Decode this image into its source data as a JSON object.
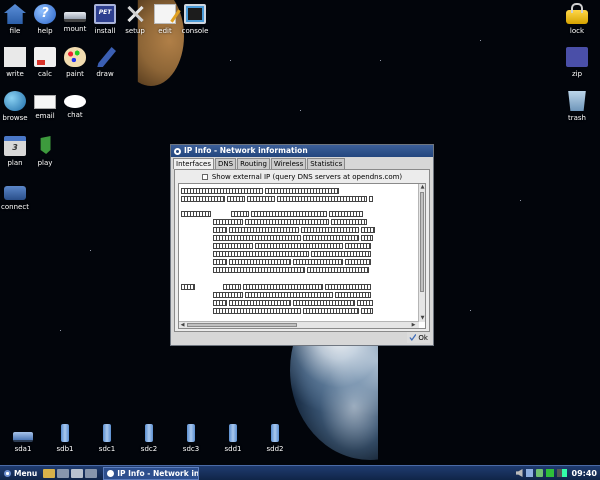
{
  "desktop": {
    "icons_left": [
      {
        "label": "file",
        "icon": "home-icon"
      },
      {
        "label": "help",
        "icon": "help-icon"
      },
      {
        "label": "mount",
        "icon": "drive-icon"
      },
      {
        "label": "install",
        "icon": "install-icon"
      },
      {
        "label": "setup",
        "icon": "tools-icon"
      },
      {
        "label": "edit",
        "icon": "edit-icon"
      },
      {
        "label": "console",
        "icon": "console-icon"
      },
      {
        "label": "write",
        "icon": "write-icon"
      },
      {
        "label": "calc",
        "icon": "calc-icon"
      },
      {
        "label": "paint",
        "icon": "paint-icon"
      },
      {
        "label": "draw",
        "icon": "draw-icon"
      },
      {
        "label": "browse",
        "icon": "globe-icon"
      },
      {
        "label": "email",
        "icon": "email-icon"
      },
      {
        "label": "chat",
        "icon": "chat-icon"
      },
      {
        "label": "plan",
        "icon": "calendar-icon"
      },
      {
        "label": "play",
        "icon": "media-icon"
      },
      {
        "label": "connect",
        "icon": "connect-icon"
      }
    ],
    "icons_right": [
      {
        "label": "lock",
        "icon": "lock-icon"
      },
      {
        "label": "zip",
        "icon": "zip-icon"
      },
      {
        "label": "trash",
        "icon": "trash-icon"
      }
    ],
    "drives": [
      {
        "label": "sda1",
        "icon": "hard-drive-icon"
      },
      {
        "label": "sdb1",
        "icon": "usb-drive-icon"
      },
      {
        "label": "sdc1",
        "icon": "usb-drive-icon"
      },
      {
        "label": "sdc2",
        "icon": "usb-drive-icon"
      },
      {
        "label": "sdc3",
        "icon": "usb-drive-icon"
      },
      {
        "label": "sdd1",
        "icon": "usb-drive-icon"
      },
      {
        "label": "sdd2",
        "icon": "usb-drive-icon"
      }
    ]
  },
  "window": {
    "title": "IP Info - Network information",
    "tabs": [
      "Interfaces",
      "DNS",
      "Routing",
      "Wireless",
      "Statistics"
    ],
    "active_tab": "Interfaces",
    "checkbox_label": "Show external IP  (query DNS servers at opendns.com)",
    "checkbox_checked": false,
    "ok_label": "Ok"
  },
  "taskbar": {
    "menu_label": "Menu",
    "task_label": "IP Info - Network inform",
    "clock": "09:40"
  }
}
